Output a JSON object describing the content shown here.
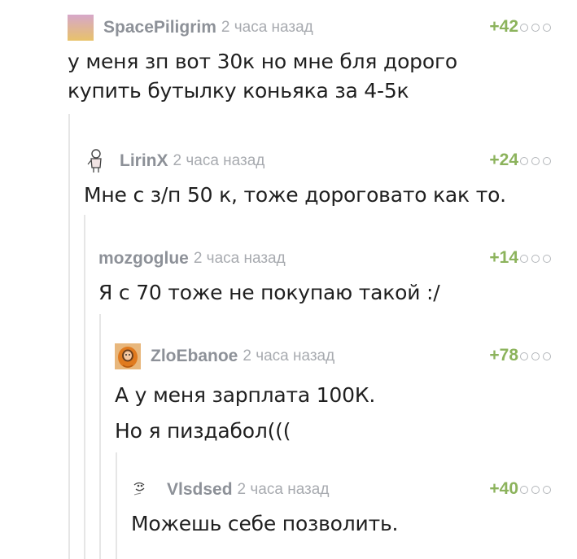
{
  "comments": [
    {
      "username": "SpacePiligrim",
      "time": "2 часа назад",
      "rating": "+42",
      "lines": [
        "у меня зп вот 30к но мне бля дорого",
        "купить бутылку коньяка за 4-5к"
      ],
      "avatar_icon": "gradient-square-avatar"
    },
    {
      "username": "LirinX",
      "time": "2 часа назад",
      "rating": "+24",
      "lines": [
        "Мне с з/п 50 к, тоже дороговато как то."
      ],
      "avatar_icon": "stick-figure-avatar"
    },
    {
      "username": "mozgoglue",
      "time": "2 часа назад",
      "rating": "+14",
      "lines": [
        "Я с 70 тоже не покупаю такой :/"
      ],
      "avatar_icon": ""
    },
    {
      "username": "ZloEbanoe",
      "time": "2 часа назад",
      "rating": "+78",
      "lines": [
        "А у меня зарплата 100К.",
        "Но я пиздабол((("
      ],
      "avatar_icon": "hooded-character-avatar"
    },
    {
      "username": "Vlsdsed",
      "time": "2 часа назад",
      "rating": "+40",
      "lines": [
        "Можешь себе позволить."
      ],
      "avatar_icon": "smiley-sketch-avatar"
    }
  ],
  "colors": {
    "rating": "#8cb35c",
    "username": "#8d9198",
    "time": "#a8abb0",
    "thread_line": "#e6e6e6"
  }
}
